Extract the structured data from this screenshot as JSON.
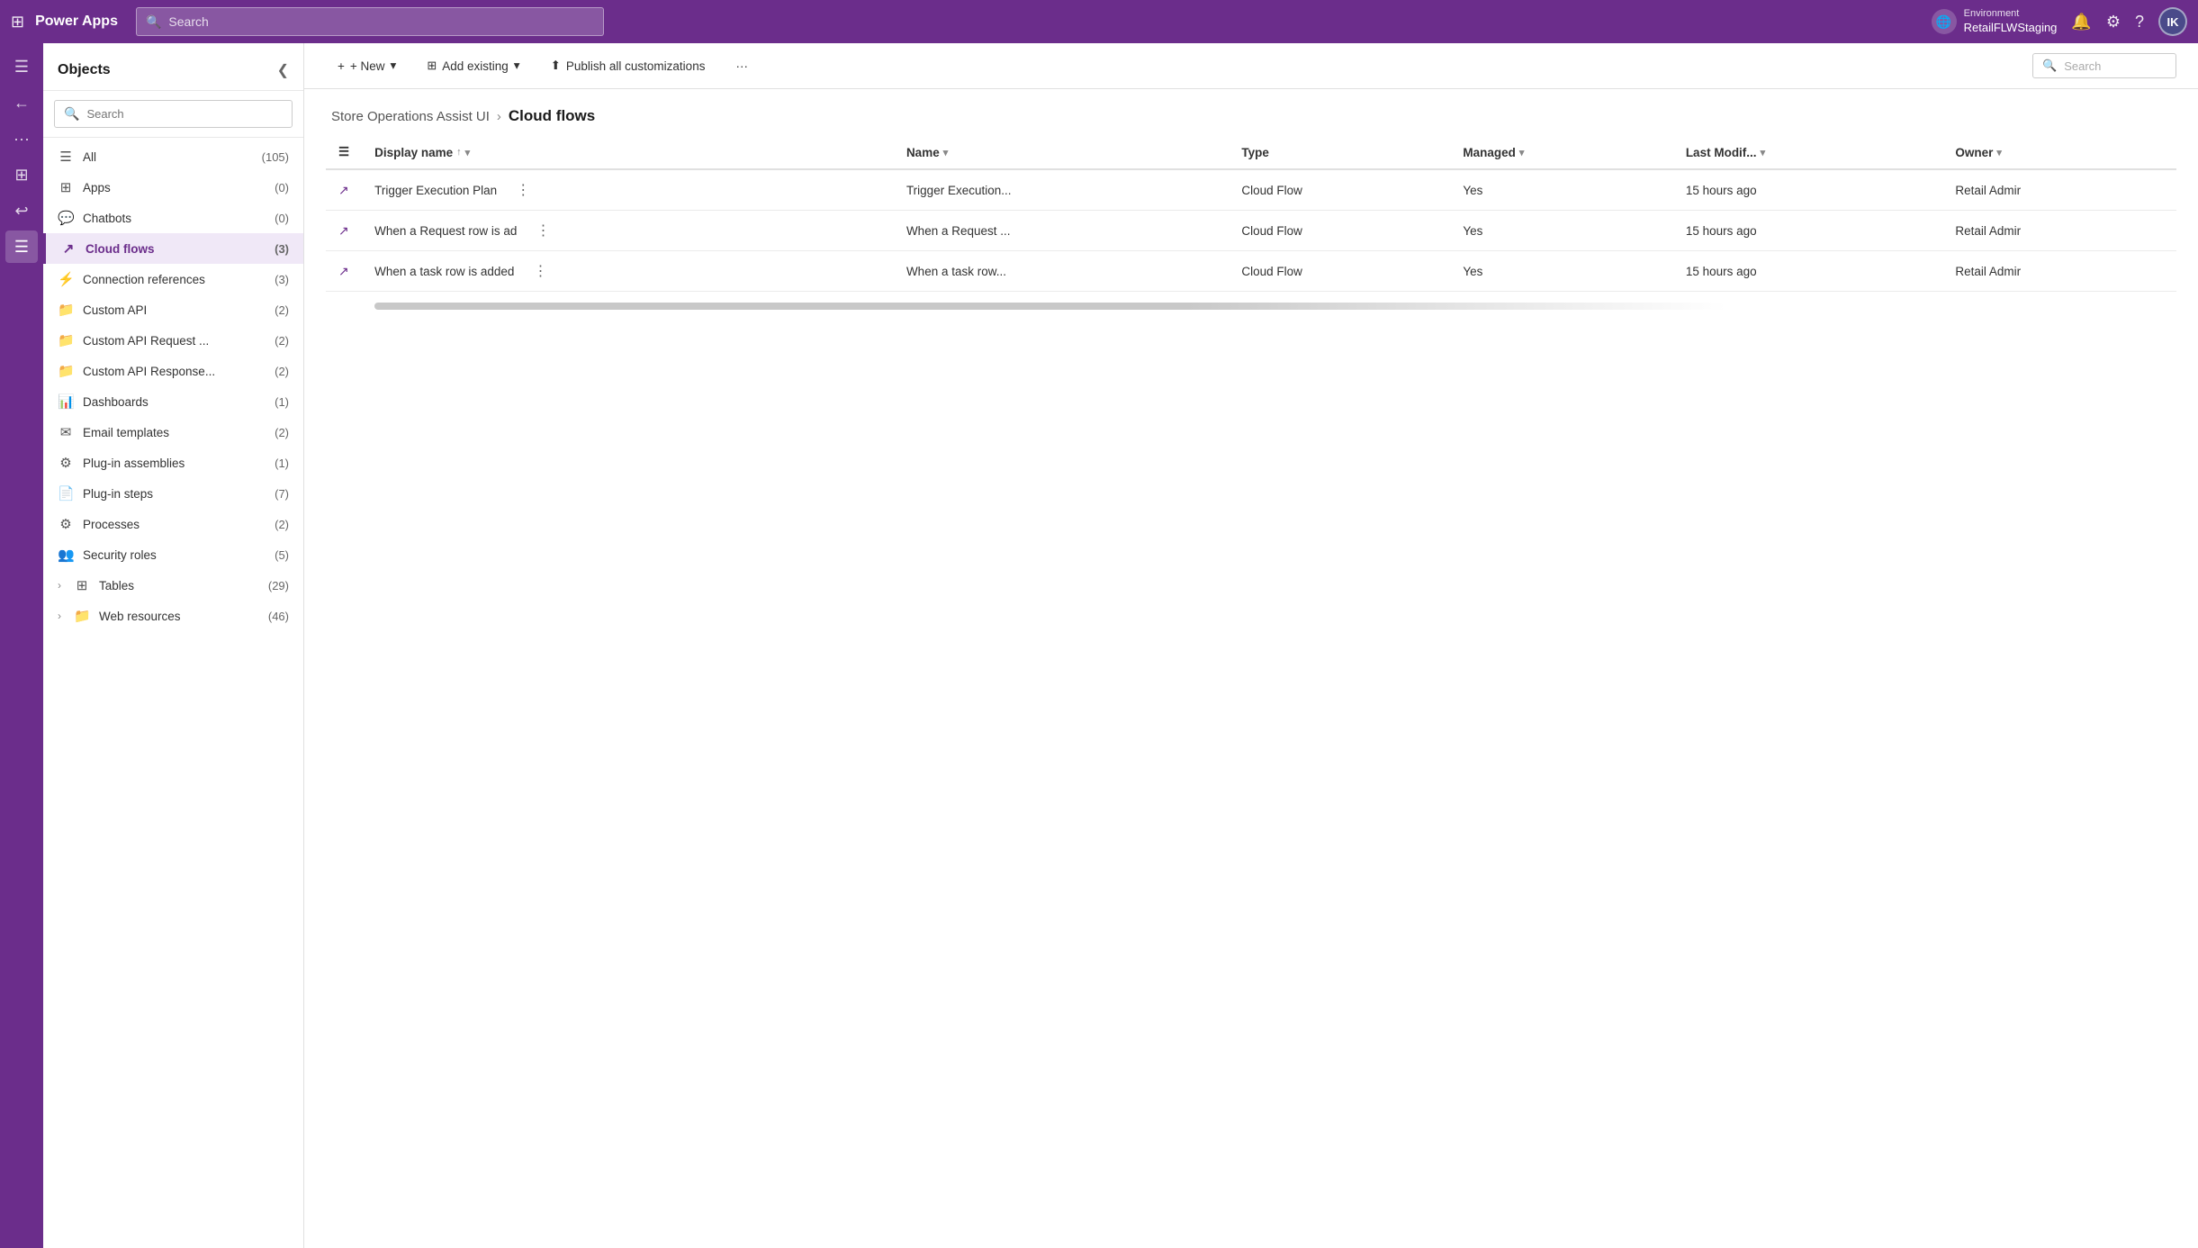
{
  "topNav": {
    "gridIconLabel": "⊞",
    "logoText": "Power Apps",
    "searchPlaceholder": "Search",
    "envLabel": "Environment",
    "envName": "RetailFLWStaging",
    "envIconText": "🌐",
    "bellIcon": "🔔",
    "settingsIcon": "⚙",
    "helpIcon": "?",
    "avatarText": "IK"
  },
  "iconRail": {
    "items": [
      {
        "name": "hamburger-rail-icon",
        "icon": "☰"
      },
      {
        "name": "back-rail-icon",
        "icon": "←"
      },
      {
        "name": "dots-rail-icon",
        "icon": "⋯"
      },
      {
        "name": "apps-rail-icon",
        "icon": "⊞"
      },
      {
        "name": "history-rail-icon",
        "icon": "↩"
      },
      {
        "name": "list-rail-icon",
        "icon": "☰",
        "active": true
      }
    ]
  },
  "sidebar": {
    "title": "Objects",
    "searchPlaceholder": "Search",
    "items": [
      {
        "name": "all",
        "icon": "☰",
        "label": "All",
        "count": "(105)",
        "expand": false
      },
      {
        "name": "apps",
        "icon": "⊞",
        "label": "Apps",
        "count": "(0)",
        "expand": false
      },
      {
        "name": "chatbots",
        "icon": "💬",
        "label": "Chatbots",
        "count": "(0)",
        "expand": false
      },
      {
        "name": "cloud-flows",
        "icon": "↗",
        "label": "Cloud flows",
        "count": "(3)",
        "expand": false,
        "active": true
      },
      {
        "name": "connection-references",
        "icon": "⚡",
        "label": "Connection references",
        "count": "(3)",
        "expand": false
      },
      {
        "name": "custom-api",
        "icon": "📁",
        "label": "Custom API",
        "count": "(2)",
        "expand": false
      },
      {
        "name": "custom-api-request",
        "icon": "📁",
        "label": "Custom API Request ...",
        "count": "(2)",
        "expand": false
      },
      {
        "name": "custom-api-response",
        "icon": "📁",
        "label": "Custom API Response...",
        "count": "(2)",
        "expand": false
      },
      {
        "name": "dashboards",
        "icon": "📊",
        "label": "Dashboards",
        "count": "(1)",
        "expand": false
      },
      {
        "name": "email-templates",
        "icon": "✉",
        "label": "Email templates",
        "count": "(2)",
        "expand": false
      },
      {
        "name": "plugin-assemblies",
        "icon": "⚙",
        "label": "Plug-in assemblies",
        "count": "(1)",
        "expand": false
      },
      {
        "name": "plug-in-steps",
        "icon": "📄",
        "label": "Plug-in steps",
        "count": "(7)",
        "expand": false
      },
      {
        "name": "processes",
        "icon": "⚙",
        "label": "Processes",
        "count": "(2)",
        "expand": false
      },
      {
        "name": "security-roles",
        "icon": "👥",
        "label": "Security roles",
        "count": "(5)",
        "expand": false
      },
      {
        "name": "tables",
        "icon": "⊞",
        "label": "Tables",
        "count": "(29)",
        "expand": true
      },
      {
        "name": "web-resources",
        "icon": "📁",
        "label": "Web resources",
        "count": "(46)",
        "expand": true
      }
    ]
  },
  "toolbar": {
    "newLabel": "+ New",
    "newDropdownIcon": "▾",
    "addExistingLabel": "Add existing",
    "addExistingDropdownIcon": "▾",
    "publishLabel": "Publish all customizations",
    "moreBtn": "···",
    "searchPlaceholder": "Search"
  },
  "breadcrumb": {
    "parentLabel": "Store Operations Assist UI",
    "separator": "›",
    "currentLabel": "Cloud flows"
  },
  "table": {
    "columns": [
      {
        "name": "display-name-col",
        "label": "Display name",
        "sortAsc": true,
        "hasSortIcon": true,
        "hasDropdown": true
      },
      {
        "name": "name-col",
        "label": "Name",
        "hasSortIcon": false,
        "hasDropdown": true
      },
      {
        "name": "type-col",
        "label": "Type",
        "hasSortIcon": false,
        "hasDropdown": false
      },
      {
        "name": "managed-col",
        "label": "Managed",
        "hasSortIcon": false,
        "hasDropdown": true
      },
      {
        "name": "last-modified-col",
        "label": "Last Modif...",
        "hasSortIcon": false,
        "hasDropdown": true
      },
      {
        "name": "owner-col",
        "label": "Owner",
        "hasSortIcon": false,
        "hasDropdown": true
      }
    ],
    "rows": [
      {
        "displayName": "Trigger Execution Plan",
        "name": "Trigger Execution...",
        "type": "Cloud Flow",
        "managed": "Yes",
        "lastModified": "15 hours ago",
        "owner": "Retail Admir"
      },
      {
        "displayName": "When a Request row is ad",
        "name": "When a Request ...",
        "type": "Cloud Flow",
        "managed": "Yes",
        "lastModified": "15 hours ago",
        "owner": "Retail Admir"
      },
      {
        "displayName": "When a task row is added",
        "name": "When a task row...",
        "type": "Cloud Flow",
        "managed": "Yes",
        "lastModified": "15 hours ago",
        "owner": "Retail Admir"
      }
    ]
  }
}
